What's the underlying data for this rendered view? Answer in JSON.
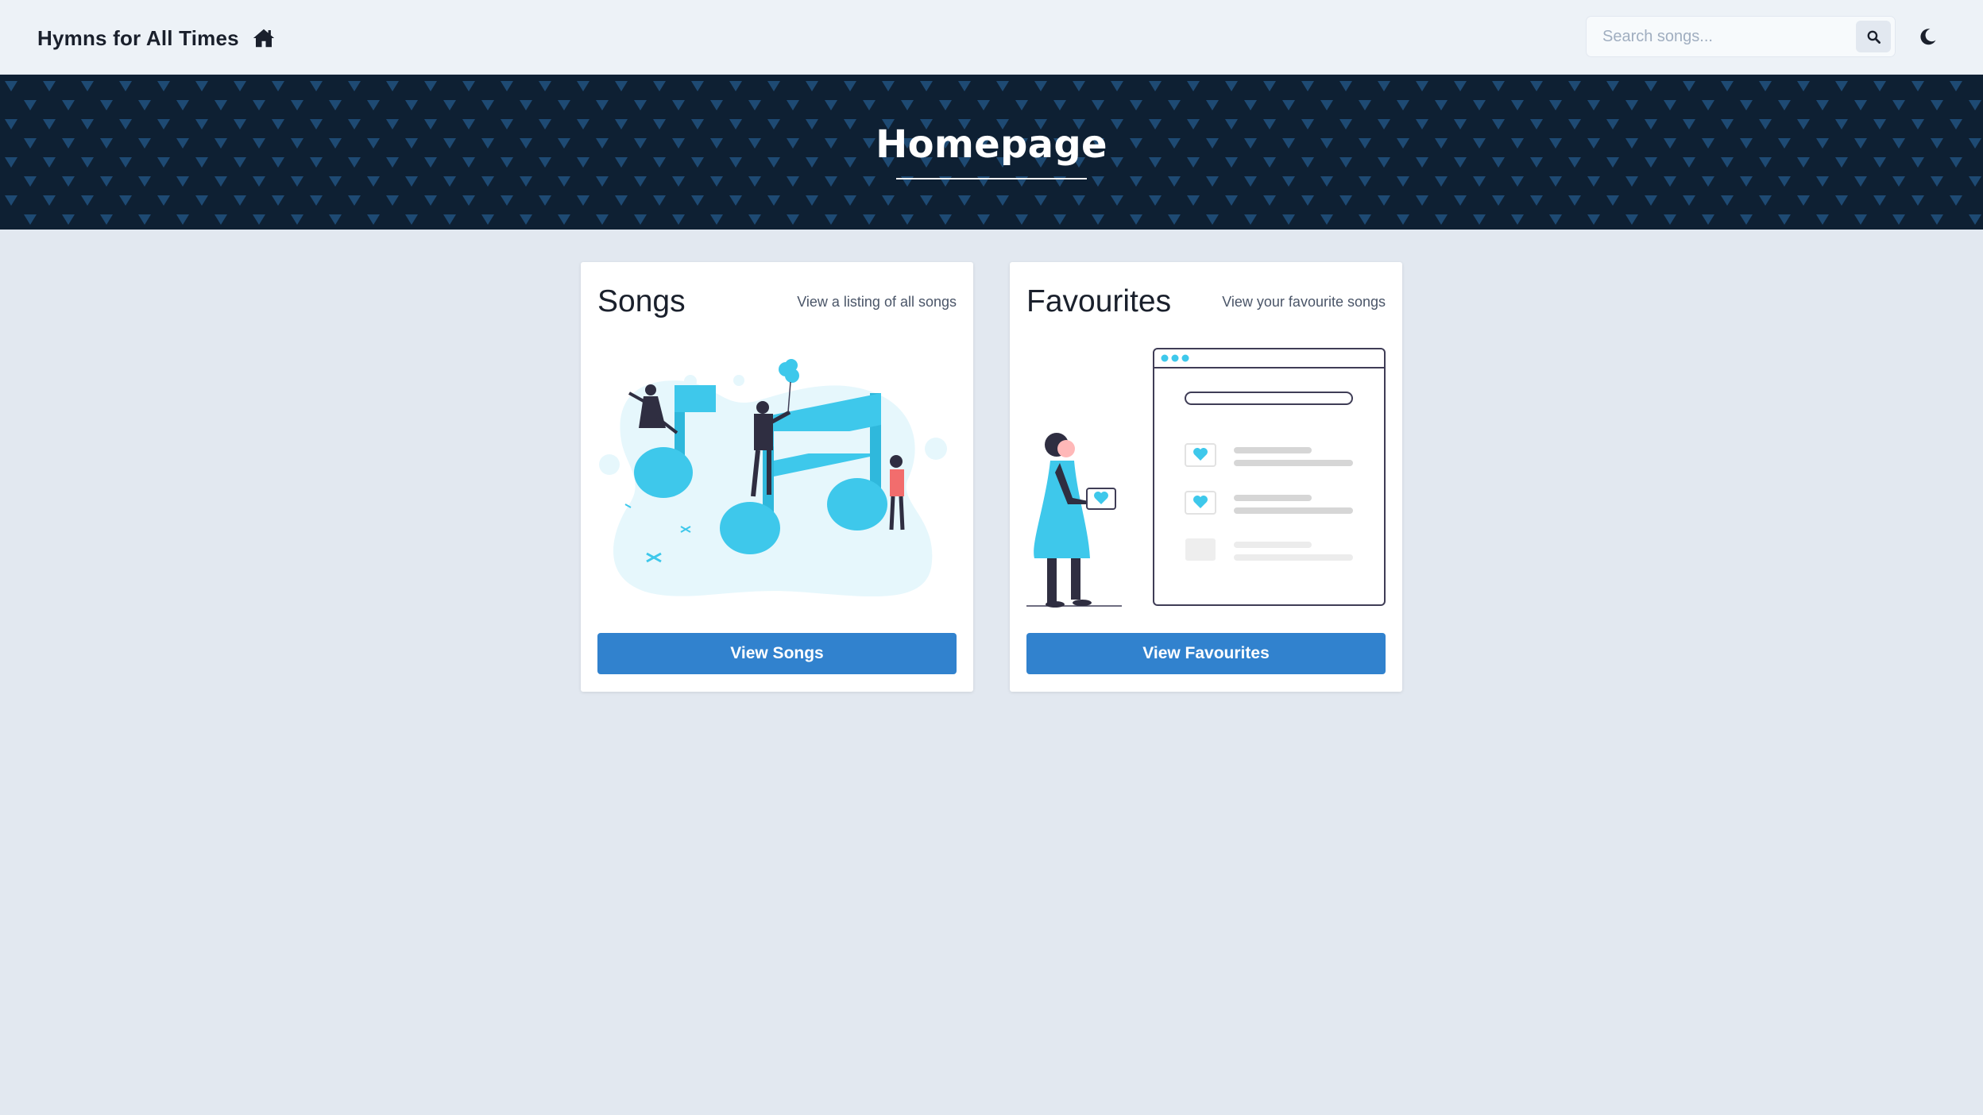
{
  "navbar": {
    "brand_title": "Hymns for All Times",
    "brand_icon": "home-icon",
    "search": {
      "placeholder": "Search songs...",
      "value": "",
      "icon": "search-icon"
    },
    "theme_toggle_icon": "moon-icon"
  },
  "hero": {
    "title": "Homepage",
    "background_color": "#0e2033",
    "pattern_color": "#1e4a73"
  },
  "cards": [
    {
      "title": "Songs",
      "subtitle": "View a listing of all songs",
      "illustration": "music-notes-people-illustration",
      "button_label": "View Songs"
    },
    {
      "title": "Favourites",
      "subtitle": "View your favourite songs",
      "illustration": "favourites-list-illustration",
      "button_label": "View Favourites"
    }
  ],
  "colors": {
    "accent": "#3182ce",
    "illustration_blue": "#3ec8eb",
    "page_bg": "#e2e8f0",
    "navbar_bg": "#edf2f7"
  }
}
